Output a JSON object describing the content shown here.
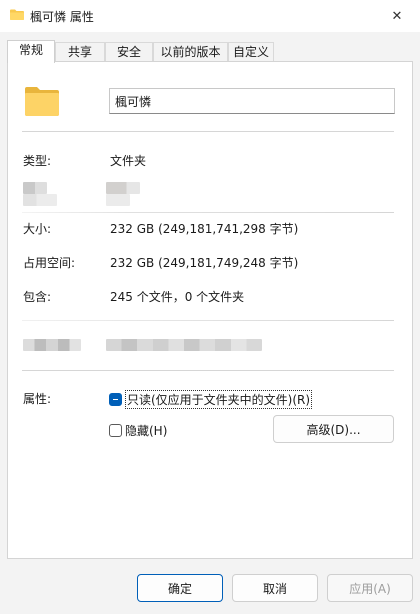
{
  "window": {
    "title": "楓可憐 属性",
    "close_glyph": "✕"
  },
  "tabs": [
    {
      "label": "常规",
      "active": true
    },
    {
      "label": "共享",
      "active": false
    },
    {
      "label": "安全",
      "active": false
    },
    {
      "label": "以前的版本",
      "active": false
    },
    {
      "label": "自定义",
      "active": false
    }
  ],
  "general": {
    "folder_name": "楓可憐",
    "type_label": "类型:",
    "type_value": "文件夹",
    "size_label": "大小:",
    "size_value": "232 GB (249,181,741,298 字节)",
    "disk_size_label": "占用空间:",
    "disk_size_value": "232 GB (249,181,749,248 字节)",
    "contains_label": "包含:",
    "contains_value": "245 个文件，0 个文件夹"
  },
  "attributes": {
    "label": "属性:",
    "readonly_label": "只读(仅应用于文件夹中的文件)(R)",
    "hidden_label": "隐藏(H)",
    "advanced_label": "高级(D)..."
  },
  "footer": {
    "ok_label": "确定",
    "cancel_label": "取消",
    "apply_label": "应用(A)"
  },
  "colors": {
    "accent": "#005fb8",
    "folder": "#f8c94e"
  }
}
